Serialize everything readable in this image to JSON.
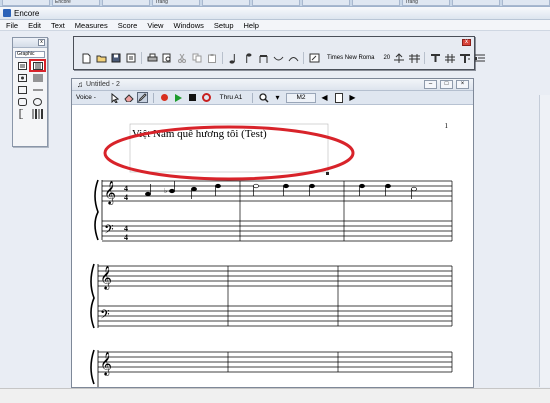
{
  "taskbar": {
    "tabs": [
      "",
      "Encore",
      "",
      "Trang",
      "",
      "",
      "",
      "",
      "Trang",
      "",
      ""
    ]
  },
  "app": {
    "title": "Encore"
  },
  "menu": {
    "items": [
      "File",
      "Edit",
      "Text",
      "Measures",
      "Score",
      "View",
      "Windows",
      "Setup",
      "Help"
    ]
  },
  "palette": {
    "close_label": "x",
    "select_value": "Graphic"
  },
  "toolbar": {
    "close_label": "x",
    "font_name": "Times New Roma",
    "font_size": "20"
  },
  "document": {
    "title": "Untitled - 2",
    "voice_label": "Voice -",
    "thru_label": "Thru A1",
    "measure_label": "M2",
    "page_number": "1",
    "song_title": "Việt Nam quê hương tôi (Test)"
  },
  "colors": {
    "highlight_ellipse": "#d8232a",
    "palette_selection": "#d8232a",
    "record_button": "#d83020",
    "play_button": "#1d9b2c"
  }
}
